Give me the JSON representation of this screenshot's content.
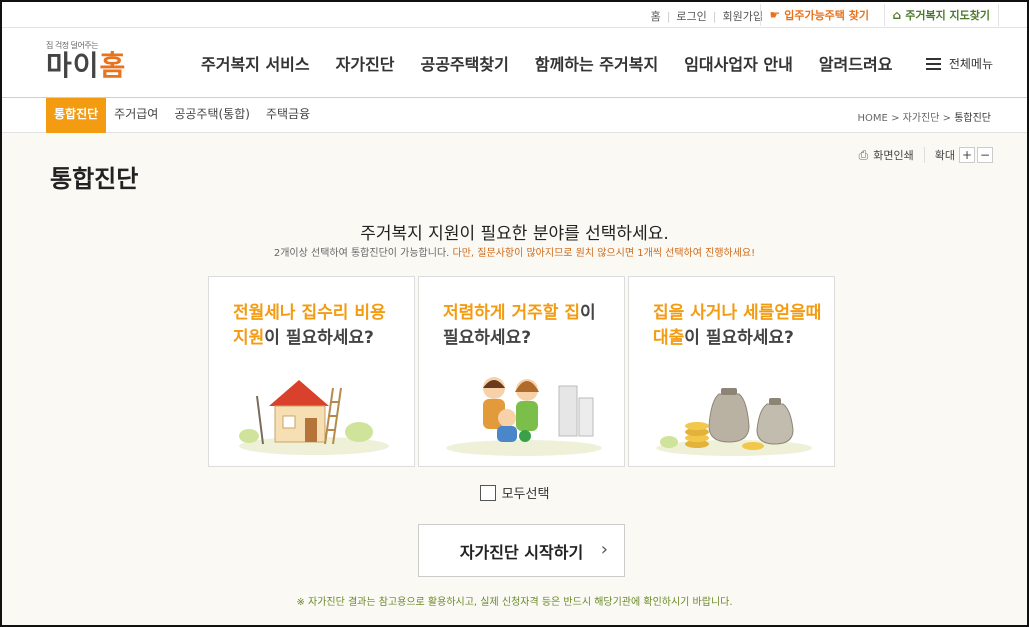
{
  "topbar": {
    "links": [
      "홈",
      "로그인",
      "회원가입"
    ],
    "move_in_label": "입주가능주택 찾기",
    "map_label": "주거복지 지도찾기"
  },
  "logo": {
    "tagline": "집 걱정 덜어주는",
    "name_a": "마이",
    "name_b": "홈"
  },
  "gnb": [
    "주거복지 서비스",
    "자가진단",
    "공공주택찾기",
    "함께하는 주거복지",
    "임대사업자 안내",
    "알려드려요"
  ],
  "all_menu_label": "전체메뉴",
  "subnav": {
    "tabs": [
      "통합진단",
      "주거급여",
      "공공주택(통합)",
      "주택금융"
    ],
    "breadcrumb": [
      "HOME",
      "자가진단",
      "통합진단"
    ]
  },
  "page": {
    "title": "통합진단",
    "print_label": "화면인쇄",
    "zoom_label": "확대",
    "zoom_in": "+",
    "zoom_out": "−"
  },
  "headline": "주거복지 지원이 필요한 분야를 선택하세요.",
  "subline_normal": "2개이상 선택하여 통합진단이 가능합니다.",
  "subline_warn": "다만, 질문사항이 많아지므로 원치 않으시면 1개씩 선택하여 진행하세요!",
  "cards": [
    {
      "hl1": "전월세나 집수리 비용",
      "hl2": "지원",
      "rest2": "이 필요하세요?"
    },
    {
      "pre1": "저렴하게 거주할 집",
      "post1": "이",
      "line2": "필요하세요?"
    },
    {
      "hl1": "집을 사거나 세를얻을때",
      "hl2": "대출",
      "rest2": "이 필요하세요?"
    }
  ],
  "select_all_label": "모두선택",
  "start_label": "자가진단 시작하기",
  "start_chevron": "›",
  "note": "※ 자가진단 결과는 참고용으로 활용하시고, 실제 신청자격 등은 반드시 해당기관에 확인하시기 바랍니다.",
  "colors": {
    "accent": "#f39c12",
    "brand": "#e8731c",
    "map_green": "#4a7a2a",
    "note_green": "#6a8a2a"
  }
}
